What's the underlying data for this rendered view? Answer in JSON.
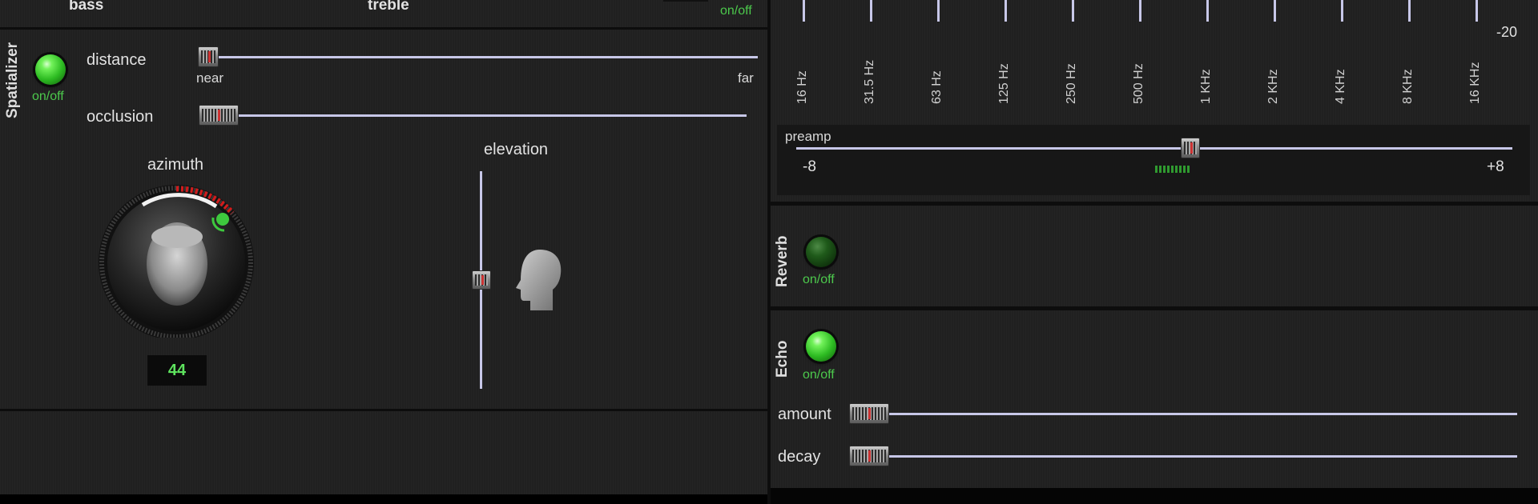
{
  "top_left": {
    "bass_label": "bass",
    "treble_label": "treble",
    "onoff_label": "on/off"
  },
  "spatializer": {
    "title": "Spatializer",
    "toggle_label": "on/off",
    "distance": {
      "label": "distance",
      "min_label": "near",
      "max_label": "far",
      "value": 0.02
    },
    "occlusion": {
      "label": "occlusion",
      "value": 0.05
    },
    "azimuth": {
      "label": "azimuth",
      "value": "44"
    },
    "elevation": {
      "label": "elevation",
      "value": 0.5
    }
  },
  "equalizer": {
    "db_label": "-20",
    "bands": [
      "16 Hz",
      "31.5 Hz",
      "63 Hz",
      "125 Hz",
      "250 Hz",
      "500 Hz",
      "1 KHz",
      "2 KHz",
      "4 KHz",
      "8 KHz",
      "16 KHz"
    ],
    "preamp": {
      "label": "preamp",
      "min_label": "-8",
      "max_label": "+8",
      "value": 0.55
    }
  },
  "reverb": {
    "title": "Reverb",
    "toggle_label": "on/off"
  },
  "echo": {
    "title": "Echo",
    "toggle_label": "on/off",
    "amount": {
      "label": "amount",
      "value": 0.0
    },
    "decay": {
      "label": "decay",
      "value": 0.0
    }
  },
  "colors": {
    "accent_green": "#4cc94c",
    "track": "#c7c7e8",
    "panel": "#202020"
  }
}
